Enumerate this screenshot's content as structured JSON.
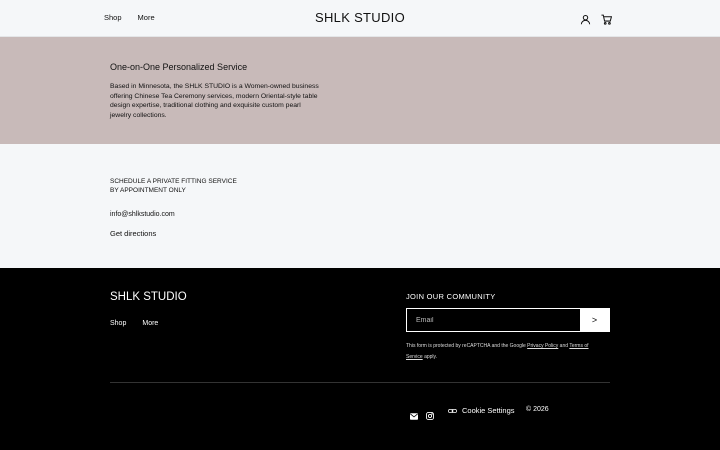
{
  "header": {
    "nav": [
      "Shop",
      "More"
    ],
    "brand": "SHLK STUDIO",
    "icons": [
      "account-icon",
      "cart-icon"
    ]
  },
  "hero": {
    "title": "One-on-One Personalized Service",
    "body": "Based in Minnesota, the SHLK STUDIO is a Women-owned business offering Chinese Tea Ceremony services, modern Oriental-style table design expertise, traditional clothing and exquisite custom pearl jewelry collections."
  },
  "contact": {
    "schedule_line1": "SCHEDULE A PRIVATE FITTING SERVICE",
    "schedule_line2": "BY APPOINTMENT ONLY",
    "email": "info@shlkstudio.com",
    "directions": "Get directions"
  },
  "footer": {
    "brand": "SHLK STUDIO",
    "nav": [
      "Shop",
      "More"
    ],
    "join_title": "JOIN OUR COMMUNITY",
    "email_placeholder": "Email",
    "submit_label": ">",
    "recaptcha": {
      "prefix": "This form is protected by reCAPTCHA and the Google ",
      "privacy": "Privacy Policy",
      "and": " and ",
      "terms": "Terms of Service",
      "suffix": " apply."
    },
    "cookie_settings": "Cookie Settings",
    "copyright": "© 2026"
  },
  "colors": {
    "background": "#f5f7f9",
    "hero": "#c8bab9",
    "footer": "#000000"
  }
}
